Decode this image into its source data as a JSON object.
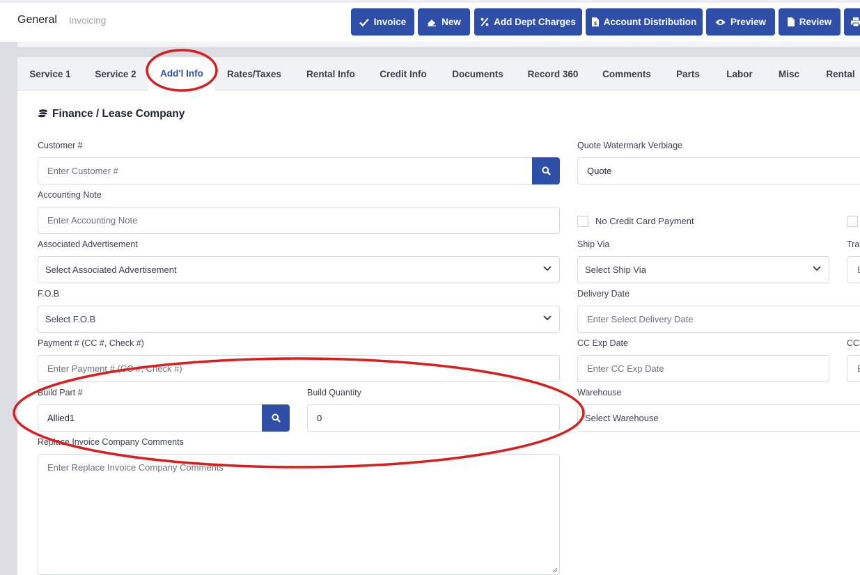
{
  "header": {
    "title": "General",
    "subtitle": "Invoicing"
  },
  "toolbar": {
    "buttons": [
      {
        "label": "Invoice",
        "icon": "check-icon"
      },
      {
        "label": "New",
        "icon": "eraser-icon"
      },
      {
        "label": "Add Dept Charges",
        "icon": "percent-icon"
      },
      {
        "label": "Account Distribution",
        "icon": "document-dollar-icon"
      },
      {
        "label": "Preview",
        "icon": "eye-icon"
      },
      {
        "label": "Review",
        "icon": "file-icon"
      },
      {
        "label": "",
        "icon": "print-icon"
      }
    ]
  },
  "tabs": [
    "Service 1",
    "Service 2",
    "Add'l Info",
    "Rates/Taxes",
    "Rental Info",
    "Credit Info",
    "Documents",
    "Record 360",
    "Comments",
    "Parts",
    "Labor",
    "Misc",
    "Rental"
  ],
  "active_tab": "Add'l Info",
  "section": {
    "title": "Finance / Lease Company",
    "icon": "coins-icon"
  },
  "form": {
    "customer": {
      "label": "Customer #",
      "placeholder": "Enter Customer #"
    },
    "accounting_note": {
      "label": "Accounting Note",
      "placeholder": "Enter Accounting Note"
    },
    "associated_ad": {
      "label": "Associated Advertisement",
      "value": "Select Associated Advertisement"
    },
    "fob": {
      "label": "F.O.B",
      "value": "Select F.O.B"
    },
    "payment": {
      "label": "Payment # (CC #, Check #)",
      "placeholder": "Enter Payment # (CC #, Check #)"
    },
    "build_part": {
      "label": "Build Part #",
      "value": "Allied1"
    },
    "build_quantity": {
      "label": "Build Quantity",
      "value": "0"
    },
    "replace_comments": {
      "label": "Replace Invoice Company Comments",
      "placeholder": "Enter Replace Invoice Company Comments"
    },
    "quote_watermark": {
      "label": "Quote Watermark Verbiage",
      "value": "Quote"
    },
    "no_credit_card": {
      "label": "No Credit Card Payment",
      "checked": false
    },
    "ship_via": {
      "label": "Ship Via",
      "value": "Select Ship Via"
    },
    "delivery_date": {
      "label": "Delivery Date",
      "placeholder": "Enter Select Delivery Date"
    },
    "cc_exp": {
      "label": "CC Exp Date",
      "placeholder": "Enter CC Exp Date"
    },
    "warehouse": {
      "label": "Warehouse",
      "value": "Select Warehouse"
    },
    "partial": {
      "tra_label": "Tra",
      "tra_input": "E",
      "cc_label": "CC",
      "cc_input": "E"
    }
  },
  "colors": {
    "primary": "#2e4ea8",
    "annotation": "#d81e1e"
  }
}
